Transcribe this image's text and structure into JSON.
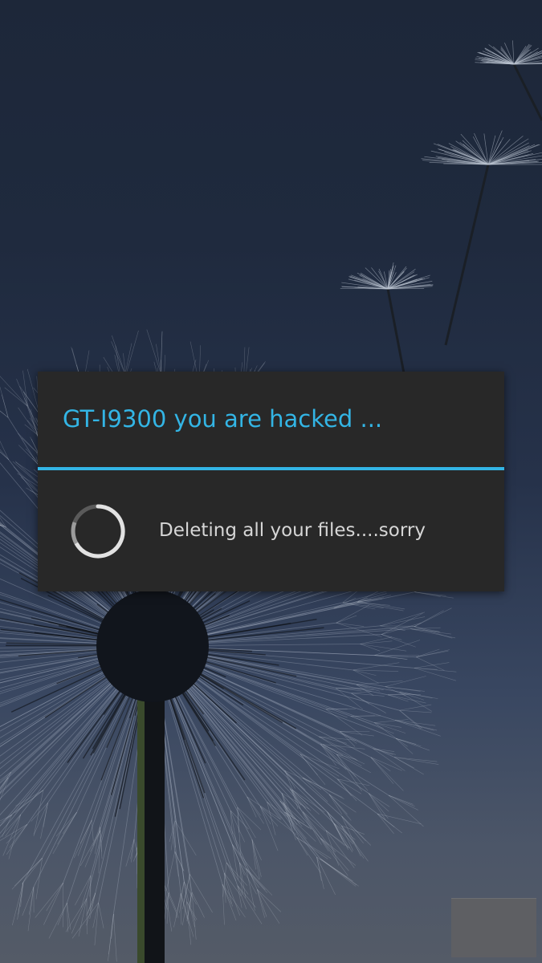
{
  "dialog": {
    "title": "GT-I9300 you are hacked ...",
    "message": "Deleting all your files....sorry",
    "accent_color": "#33b5e5",
    "background_color": "#282828",
    "icon": "progress-spinner-icon"
  },
  "wallpaper": {
    "subject": "dandelion-wallpaper",
    "colors": [
      "#1d2739",
      "#394761",
      "#545b67"
    ]
  }
}
